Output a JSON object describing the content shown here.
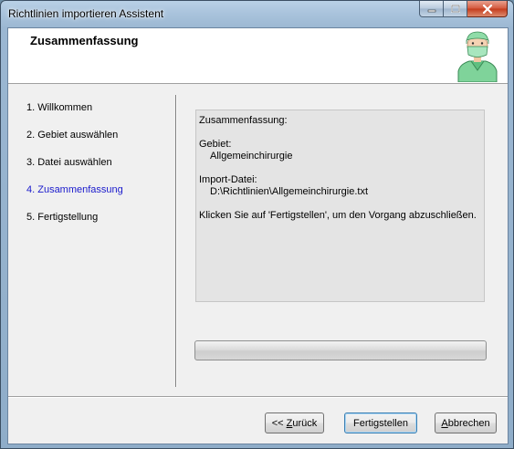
{
  "window": {
    "title": "Richtlinien importieren Assistent"
  },
  "header": {
    "title": "Zusammenfassung",
    "image": "surgeon-icon"
  },
  "nav": {
    "items": [
      {
        "label": "1. Willkommen",
        "active": false
      },
      {
        "label": "2. Gebiet auswählen",
        "active": false
      },
      {
        "label": "3. Datei auswählen",
        "active": false
      },
      {
        "label": "4. Zusammenfassung",
        "active": true
      },
      {
        "label": "5. Fertigstellung",
        "active": false
      }
    ],
    "active_color": "#1a1acc"
  },
  "summary": {
    "heading": "Zusammenfassung:",
    "area_label": "Gebiet:",
    "area_value": "Allgemeinchirurgie",
    "file_label": "Import-Datei:",
    "file_value": "D:\\Richtlinien\\Allgemeinchirurgie.txt",
    "instruction": "Klicken Sie auf 'Fertigstellen', um den Vorgang abzuschließen."
  },
  "progress": {
    "fraction": 0
  },
  "buttons": {
    "back": {
      "prefix": "<< ",
      "mnemonic": "Z",
      "rest": "urück"
    },
    "finish": {
      "label": "Fertigstellen"
    },
    "cancel": {
      "mnemonic": "A",
      "rest": "bbrechen"
    }
  }
}
